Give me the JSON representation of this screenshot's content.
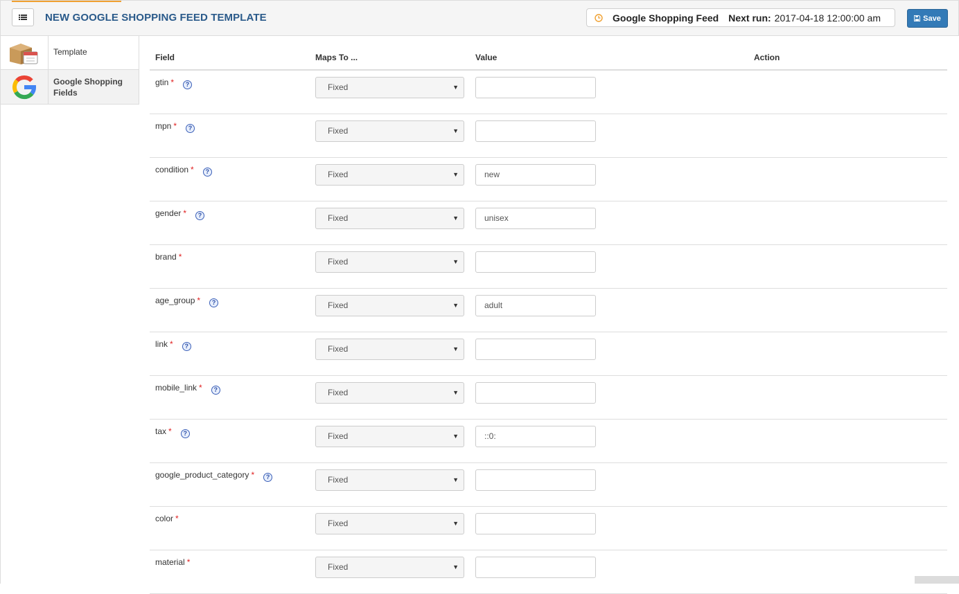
{
  "header": {
    "title": "NEW GOOGLE SHOPPING FEED TEMPLATE",
    "cron_name": "Google Shopping Feed",
    "next_run_label": "Next run:",
    "next_run_value": "2017-04-18 12:00:00 am",
    "save_label": "Save",
    "accent_color": "#f0a030",
    "title_color": "#2a5a8a",
    "save_color": "#337ab7"
  },
  "sidebar": {
    "items": [
      {
        "label": "Template",
        "icon": "package-calendar-icon"
      },
      {
        "label_line1": "Google Shopping",
        "label_line2": "Fields",
        "icon": "google-g-icon",
        "active": true
      }
    ]
  },
  "grid": {
    "headers": {
      "field": "Field",
      "maps_to": "Maps To ...",
      "value": "Value",
      "action": "Action"
    },
    "rows": [
      {
        "field": "gtin",
        "required": "*",
        "help": "?",
        "maps_to": "Fixed",
        "value": ""
      },
      {
        "field": "mpn",
        "required": "*",
        "help": "?",
        "maps_to": "Fixed",
        "value": ""
      },
      {
        "field": "condition",
        "required": "*",
        "help": "?",
        "maps_to": "Fixed",
        "value": "new"
      },
      {
        "field": "gender",
        "required": "*",
        "help": "?",
        "maps_to": "Fixed",
        "value": "unisex"
      },
      {
        "field": "brand",
        "required": "*",
        "maps_to": "Fixed",
        "value": ""
      },
      {
        "field": "age_group",
        "required": "*",
        "help": "?",
        "maps_to": "Fixed",
        "value": "adult"
      },
      {
        "field": "link",
        "required": "*",
        "help": "?",
        "maps_to": "Fixed",
        "value": ""
      },
      {
        "field": "mobile_link",
        "required": "*",
        "help": "?",
        "maps_to": "Fixed",
        "value": ""
      },
      {
        "field": "tax",
        "required": "*",
        "help": "?",
        "maps_to": "Fixed",
        "value": "::0:"
      },
      {
        "field": "google_product_category",
        "required": "*",
        "help": "?",
        "maps_to": "Fixed",
        "value": ""
      },
      {
        "field": "color",
        "required": "*",
        "maps_to": "Fixed",
        "value": ""
      },
      {
        "field": "material",
        "required": "*",
        "maps_to": "Fixed",
        "value": ""
      }
    ]
  }
}
